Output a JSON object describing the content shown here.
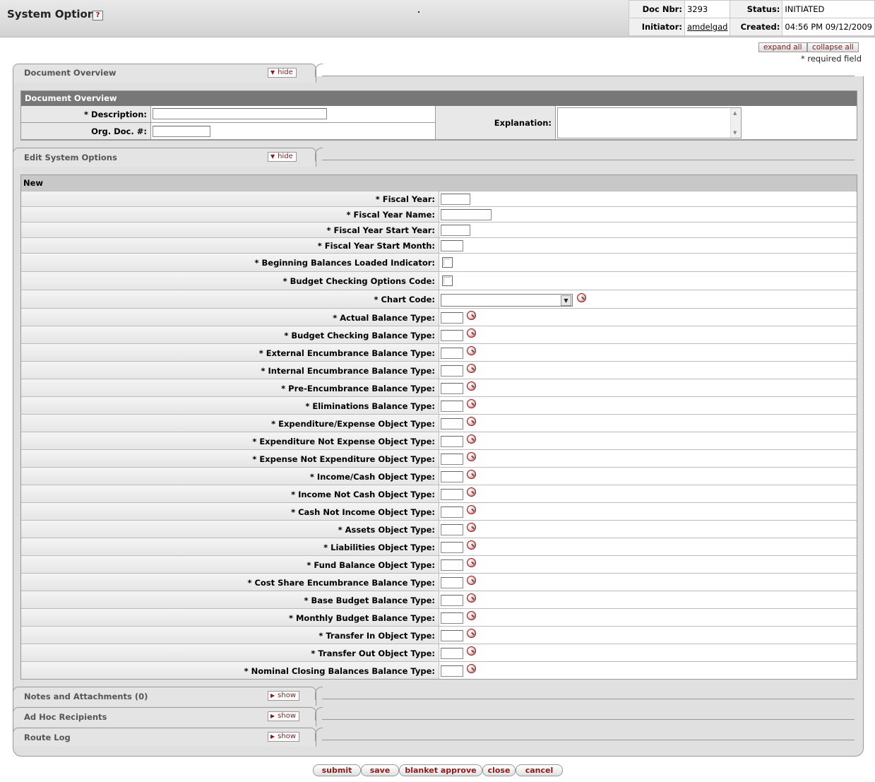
{
  "header": {
    "title": "System Options",
    "help_label": "?",
    "doc_nbr_label": "Doc Nbr:",
    "doc_nbr": "3293",
    "status_label": "Status:",
    "status": "INITIATED",
    "initiator_label": "Initiator:",
    "initiator": "amdelgad",
    "created_label": "Created:",
    "created": "04:56 PM 09/12/2009"
  },
  "toolbar": {
    "expand_all": "expand all",
    "collapse_all": "collapse all",
    "required_note": "* required field"
  },
  "tabs": {
    "document_overview": {
      "label": "Document Overview",
      "toggle": "hide"
    },
    "edit_system_options": {
      "label": "Edit System Options",
      "toggle": "hide"
    },
    "notes": {
      "label": "Notes and Attachments (0)",
      "toggle": "show"
    },
    "adhoc": {
      "label": "Ad Hoc Recipients",
      "toggle": "show"
    },
    "route_log": {
      "label": "Route Log",
      "toggle": "show"
    }
  },
  "document_overview": {
    "section_title": "Document Overview",
    "description_label": "* Description:",
    "description_value": "",
    "org_doc_label": "Org. Doc. #:",
    "org_doc_value": "",
    "explanation_label": "Explanation:",
    "explanation_value": ""
  },
  "edit_system_options": {
    "section_title": "New",
    "fields": [
      {
        "label": "*  Fiscal Year:",
        "control": "text"
      },
      {
        "label": "*  Fiscal Year Name:",
        "control": "text"
      },
      {
        "label": "*  Fiscal Year Start Year:",
        "control": "text"
      },
      {
        "label": "*  Fiscal Year Start Month:",
        "control": "text"
      },
      {
        "label": "*  Beginning Balances Loaded Indicator:",
        "control": "checkbox"
      },
      {
        "label": "*  Budget Checking Options Code:",
        "control": "checkbox"
      },
      {
        "label": "*  Chart Code:",
        "control": "select"
      },
      {
        "label": "*  Actual Balance Type:",
        "control": "lookup"
      },
      {
        "label": "*  Budget Checking Balance Type:",
        "control": "lookup"
      },
      {
        "label": "*  External Encumbrance Balance Type:",
        "control": "lookup"
      },
      {
        "label": "*  Internal Encumbrance Balance Type:",
        "control": "lookup"
      },
      {
        "label": "*  Pre-Encumbrance Balance Type:",
        "control": "lookup"
      },
      {
        "label": "*  Eliminations Balance Type:",
        "control": "lookup"
      },
      {
        "label": "*  Expenditure/Expense Object Type:",
        "control": "lookup"
      },
      {
        "label": "*  Expenditure Not Expense Object Type:",
        "control": "lookup"
      },
      {
        "label": "*  Expense Not Expenditure Object Type:",
        "control": "lookup"
      },
      {
        "label": "*  Income/Cash Object Type:",
        "control": "lookup"
      },
      {
        "label": "*  Income Not Cash Object Type:",
        "control": "lookup"
      },
      {
        "label": "*  Cash Not Income Object Type:",
        "control": "lookup"
      },
      {
        "label": "*  Assets Object Type:",
        "control": "lookup"
      },
      {
        "label": "*  Liabilities Object Type:",
        "control": "lookup"
      },
      {
        "label": "*  Fund Balance Object Type:",
        "control": "lookup"
      },
      {
        "label": "*  Cost Share Encumbrance Balance Type:",
        "control": "lookup"
      },
      {
        "label": "*  Base Budget Balance Type:",
        "control": "lookup"
      },
      {
        "label": "*  Monthly Budget Balance Type:",
        "control": "lookup"
      },
      {
        "label": "*  Transfer In Object Type:",
        "control": "lookup"
      },
      {
        "label": "*  Transfer Out Object Type:",
        "control": "lookup"
      },
      {
        "label": "*  Nominal Closing Balances Balance Type:",
        "control": "lookup"
      }
    ]
  },
  "actions": {
    "submit": "submit",
    "save": "save",
    "blanket_approve": "blanket approve",
    "close": "close",
    "cancel": "cancel"
  }
}
